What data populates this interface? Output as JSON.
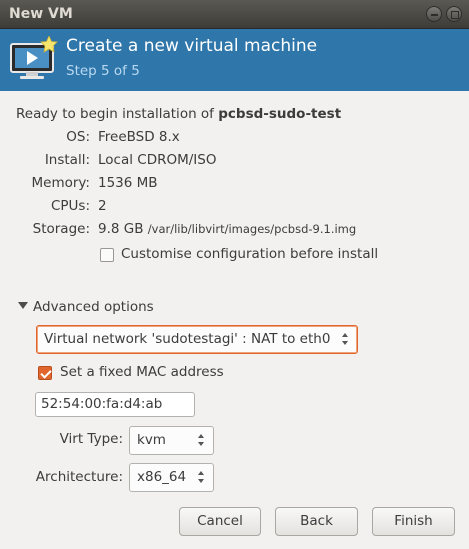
{
  "window": {
    "title": "New VM"
  },
  "banner": {
    "title": "Create a new virtual machine",
    "step": "Step 5 of 5"
  },
  "summary": {
    "ready_prefix": "Ready to begin installation of ",
    "vm_name": "pcbsd-sudo-test",
    "rows": [
      {
        "key": "OS:",
        "value": "FreeBSD 8.x"
      },
      {
        "key": "Install:",
        "value": "Local CDROM/ISO"
      },
      {
        "key": "Memory:",
        "value": "1536 MB"
      },
      {
        "key": "CPUs:",
        "value": "2"
      }
    ],
    "storage": {
      "key": "Storage:",
      "size": "9.8 GB",
      "path": "/var/lib/libvirt/images/pcbsd-9.1.img"
    }
  },
  "customise": {
    "label": "Customise configuration before install",
    "checked": false
  },
  "advanced": {
    "label": "Advanced options",
    "network": "Virtual network 'sudotestagi' : NAT to eth0",
    "fixed_mac": {
      "label": "Set a fixed MAC address",
      "checked": true
    },
    "mac_value": "52:54:00:fa:d4:ab",
    "virt_type": {
      "label": "Virt Type:",
      "value": "kvm"
    },
    "architecture": {
      "label": "Architecture:",
      "value": "x86_64"
    }
  },
  "buttons": {
    "cancel": "Cancel",
    "back": "Back",
    "finish": "Finish"
  },
  "colors": {
    "banner": "#2f76aa",
    "accent": "#e0662e",
    "titlebar": "#3d3c38"
  },
  "icons": {
    "banner": "virtual-machine-monitor-icon"
  }
}
